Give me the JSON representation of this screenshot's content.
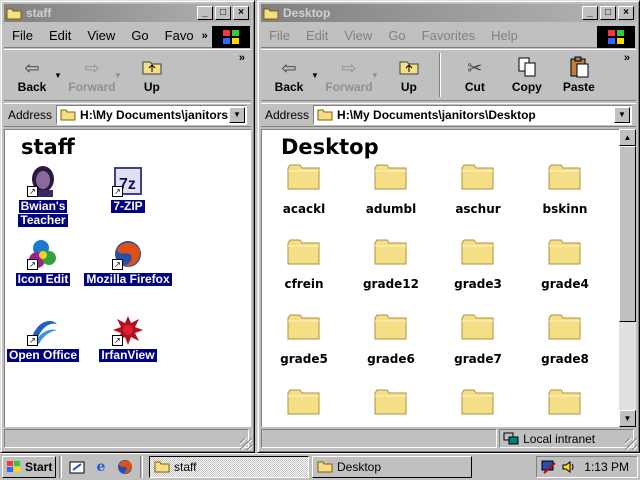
{
  "left_window": {
    "title": "staff",
    "controls": {
      "minimize": "_",
      "maximize": "□",
      "close": "×"
    },
    "menu": [
      "File",
      "Edit",
      "View",
      "Go",
      "Favo"
    ],
    "menu_more": "»",
    "toolbar": {
      "back": "Back",
      "forward": "Forward",
      "up": "Up",
      "more": "»"
    },
    "address_label": "Address",
    "address": "H:\\My Documents\\janitors",
    "content_title": "staff",
    "icons": [
      {
        "label_line1": "Bwian's",
        "label_line2": "Teacher"
      },
      {
        "label_line1": "7-ZIP",
        "label_line2": ""
      },
      {
        "label_line1": "Icon Edit",
        "label_line2": ""
      },
      {
        "label_line1": "Mozilla Firefox",
        "label_line2": ""
      },
      {
        "label_line1": "Open Office",
        "label_line2": ""
      },
      {
        "label_line1": "IrfanView",
        "label_line2": ""
      }
    ]
  },
  "right_window": {
    "title": "Desktop",
    "controls": {
      "minimize": "_",
      "maximize": "□",
      "close": "×"
    },
    "menu": [
      "File",
      "Edit",
      "View",
      "Go",
      "Favorites",
      "Help"
    ],
    "toolbar": {
      "back": "Back",
      "forward": "Forward",
      "up": "Up",
      "cut": "Cut",
      "copy": "Copy",
      "paste": "Paste",
      "more": "»"
    },
    "address_label": "Address",
    "address": "H:\\My Documents\\janitors\\Desktop",
    "content_title": "Desktop",
    "folders": [
      "acackl",
      "adumbl",
      "aschur",
      "bskinn",
      "cfrein",
      "grade12",
      "grade3",
      "grade4",
      "grade5",
      "grade6",
      "grade7",
      "grade8",
      "",
      "",
      "",
      ""
    ],
    "status_zone": "Local intranet"
  },
  "taskbar": {
    "start_label": "Start",
    "tasks": [
      "staff",
      "Desktop"
    ],
    "clock": "1:13 PM"
  },
  "colors": {
    "title_active": "#000080",
    "title_inactive": "#808080",
    "selection": "#000080",
    "folder": "#f5df86"
  }
}
